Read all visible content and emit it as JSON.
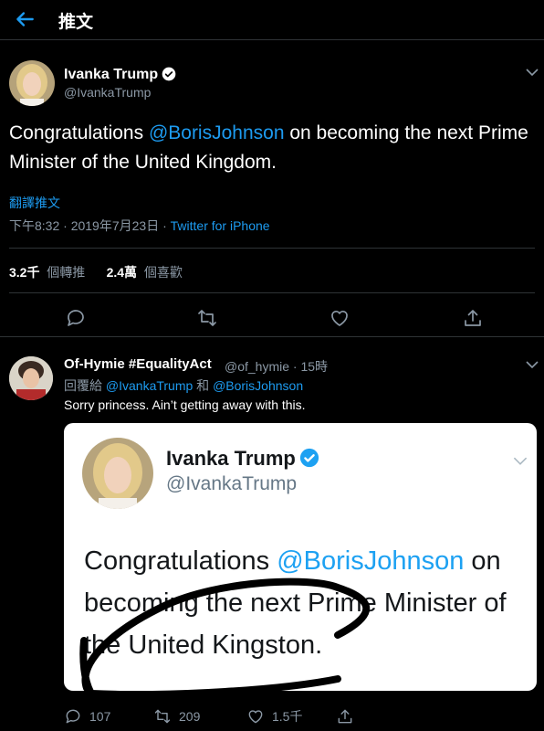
{
  "header": {
    "title": "推文"
  },
  "tweet": {
    "author_name": "Ivanka Trump",
    "author_handle": "@IvankaTrump",
    "text_before": "Congratulations ",
    "mention": "@BorisJohnson",
    "text_after": " on becoming the next Prime Minister of the United Kingdom.",
    "translate": "翻譯推文",
    "time": "下午8:32 · 2019年7月23日 · ",
    "source": "Twitter for iPhone",
    "retweets_count": "3.2千",
    "retweets_label": "個轉推",
    "likes_count": "2.4萬",
    "likes_label": "個喜歡"
  },
  "reply": {
    "author_name": "Of-Hymie #EqualityAct",
    "author_handle": "@of_hymie",
    "age": "· 15時",
    "reply_prefix": "回覆給 ",
    "reply_to_1": "@IvankaTrump",
    "reply_join": " 和 ",
    "reply_to_2": "@BorisJohnson",
    "text": "Sorry princess. Ain’t getting away with this.",
    "embed": {
      "name": "Ivanka Trump",
      "handle": "@IvankaTrump",
      "text_before": "Congratulations ",
      "mention": "@BorisJohnson",
      "text_after": " on becoming the next Prime Minister of the United Kingston."
    },
    "reply_count": "107",
    "retweet_count": "209",
    "like_count": "1.5千"
  },
  "colors": {
    "accent": "#1d9bf0",
    "background": "#000000",
    "muted": "#8b98a5"
  }
}
